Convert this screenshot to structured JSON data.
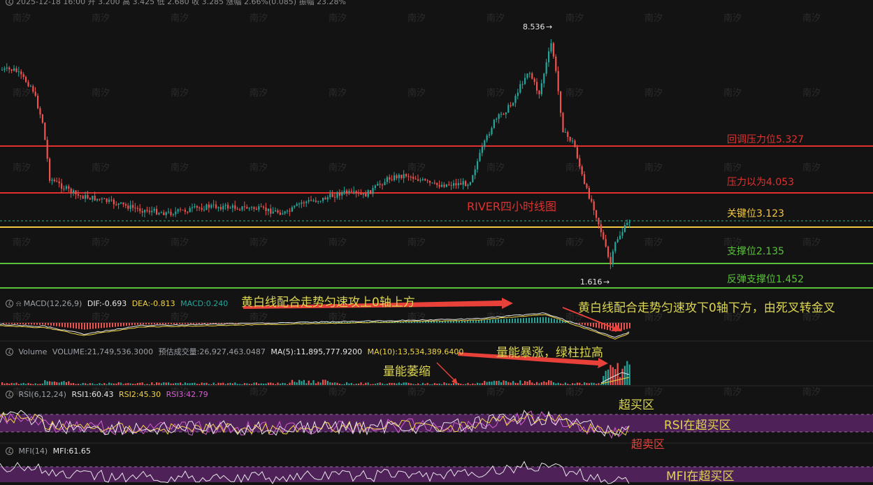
{
  "header": {
    "ohlc_text": "2025-12-18 16:00  开 3.200  高 3.425  低 2.680  收 3.285  涨幅 2.66%(0.085)  振幅 23.28%"
  },
  "watermark": "南汐",
  "price_marks": {
    "high": "8.536",
    "low": "1.616"
  },
  "levels": [
    {
      "label": "回调压力位5.327",
      "color": "#e0312f"
    },
    {
      "label": "压力以为4.053",
      "color": "#e0312f"
    },
    {
      "label": "关键位3.123",
      "color": "#f2c744"
    },
    {
      "label": "支撑位2.135",
      "color": "#59c23a"
    },
    {
      "label": "反弹支撑位1.452",
      "color": "#59c23a"
    }
  ],
  "chart_title": "RIVER四小时线图",
  "macd": {
    "title": "MACD(12,26,9)",
    "dif": "DIF:-0.693",
    "dea": "DEA:-0.813",
    "macd": "MACD:0.240",
    "annotation_left": "黄白线配合走势匀速攻上0轴上方",
    "annotation_right": "黄白线配合走势匀速攻下0轴下方，由死叉转金叉"
  },
  "volume": {
    "title": "Volume",
    "volume": "VOLUME:21,749,536.3000",
    "estimate": "预估成交量:26,927,463.0487",
    "ma5": "MA(5):11,895,777.9200",
    "ma10": "MA(10):13,534,389.6400",
    "annotation_surge": "量能暴涨，绿柱拉高",
    "annotation_shrink": "量能萎缩"
  },
  "rsi": {
    "title": "RSI(6,12,24)",
    "rsi1": "RSI1:60.43",
    "rsi2": "RSI2:45.30",
    "rsi3": "RSI3:42.79",
    "overbought": "超买区",
    "in_overbought": "RSI在超买区",
    "oversold": "超卖区"
  },
  "mfi": {
    "title": "MFI(14)",
    "mfi": "MFI:61.65",
    "in_overbought": "MFI在超买区"
  },
  "colors": {
    "up": "#26a69a",
    "down": "#ef5350",
    "dif": "#e6e6e6",
    "dea": "#f2d544",
    "rsi1": "#e6e6e6",
    "rsi2": "#f2d544",
    "rsi3": "#d35fd0",
    "band": "#6b2a78",
    "annotation": "#dcd650",
    "arrow": "#e8413a"
  }
}
